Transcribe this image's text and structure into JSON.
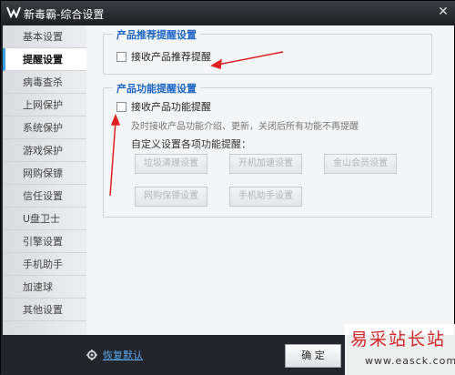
{
  "window": {
    "title": "新毒霸-综合设置"
  },
  "sidebar": {
    "items": [
      {
        "label": "基本设置"
      },
      {
        "label": "提醒设置"
      },
      {
        "label": "病毒查杀"
      },
      {
        "label": "上网保护"
      },
      {
        "label": "系统保护"
      },
      {
        "label": "游戏保护"
      },
      {
        "label": "网购保镖"
      },
      {
        "label": "信任设置"
      },
      {
        "label": "U盘卫士"
      },
      {
        "label": "引擎设置"
      },
      {
        "label": "手机助手"
      },
      {
        "label": "加速球"
      },
      {
        "label": "其他设置"
      }
    ],
    "active_index": 1
  },
  "product_recommend": {
    "title": "产品推荐提醒设置",
    "checkbox_label": "接收产品推荐提醒",
    "checked": false
  },
  "product_feature": {
    "title": "产品功能提醒设置",
    "checkbox_label": "接收产品功能提醒",
    "checked": false,
    "description": "及时接收产品功能介绍、更新，关闭后所有功能不再提醒",
    "custom_title": "自定义设置各项功能提醒：",
    "buttons": [
      {
        "label": "垃圾清理设置"
      },
      {
        "label": "开机加速设置"
      },
      {
        "label": "金山会员设置"
      },
      {
        "label": "网购保镖设置"
      },
      {
        "label": "手机助手设置"
      }
    ]
  },
  "footer": {
    "restore_label": "恢复默认",
    "ok_label": "确 定"
  },
  "watermark": {
    "name": "易采站长站",
    "url": "www.easck.com"
  },
  "colors": {
    "accent": "#1e66c8",
    "annotation_arrow": "#e02020",
    "watermark": "#d8262b"
  }
}
